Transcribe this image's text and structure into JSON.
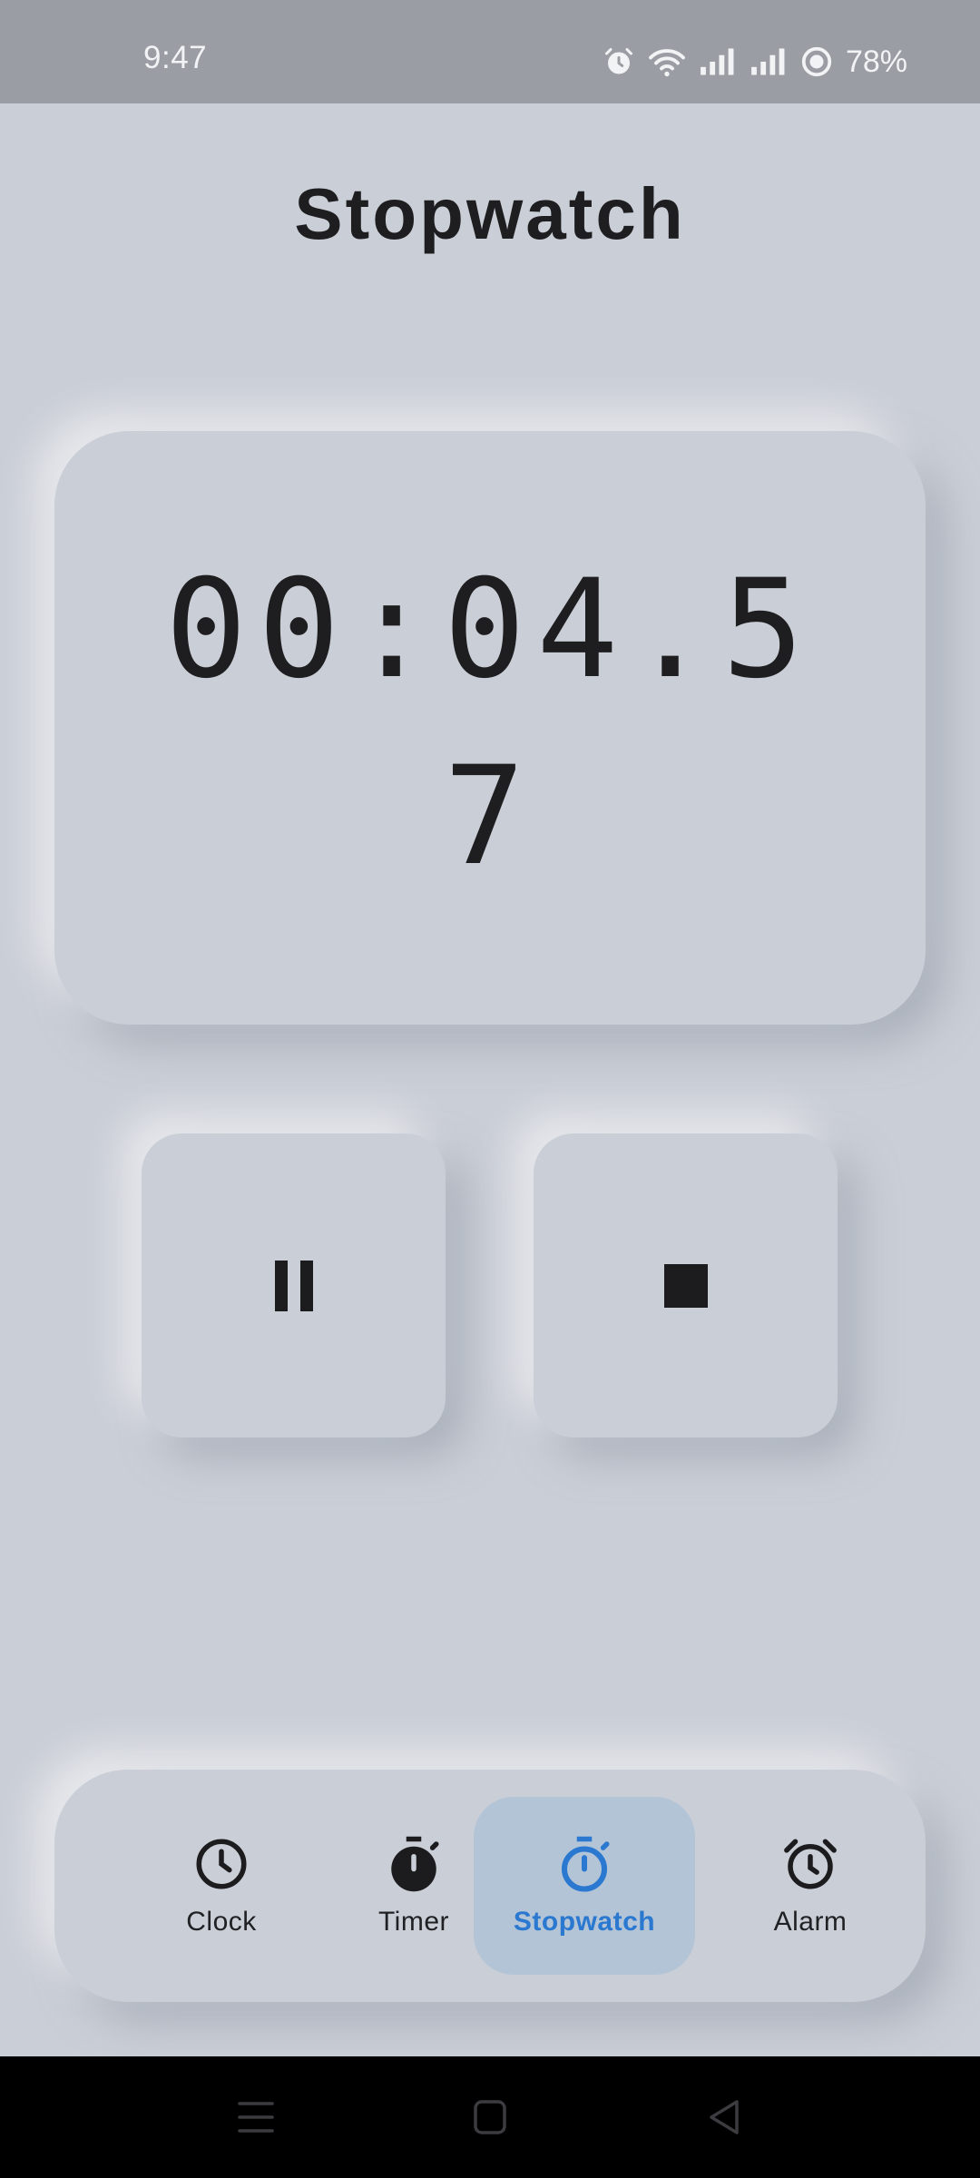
{
  "status_bar": {
    "time": "9:47",
    "battery": "78%",
    "icons": [
      "alarm-icon",
      "wifi-icon",
      "signal-icon",
      "signal-icon",
      "battery-saver-icon"
    ]
  },
  "page": {
    "title": "Stopwatch"
  },
  "stopwatch": {
    "elapsed": "00:04.57"
  },
  "controls": {
    "pause_icon": "pause-icon",
    "stop_icon": "stop-icon"
  },
  "nav": {
    "items": [
      {
        "label": "Clock",
        "icon": "clock-icon",
        "active": false
      },
      {
        "label": "Timer",
        "icon": "timer-icon",
        "active": false
      },
      {
        "label": "Stopwatch",
        "icon": "stopwatch-icon",
        "active": true
      },
      {
        "label": "Alarm",
        "icon": "alarm-icon",
        "active": false
      }
    ]
  },
  "colors": {
    "background": "#caced6",
    "status_bar": "#9a9da3",
    "accent": "#2a78cf",
    "active_tab_bg": "#b3c4d7",
    "text": "#1c1c1e",
    "system_nav": "#000000"
  },
  "system_nav": {
    "icons": [
      "recents-icon",
      "home-icon",
      "back-icon"
    ]
  }
}
